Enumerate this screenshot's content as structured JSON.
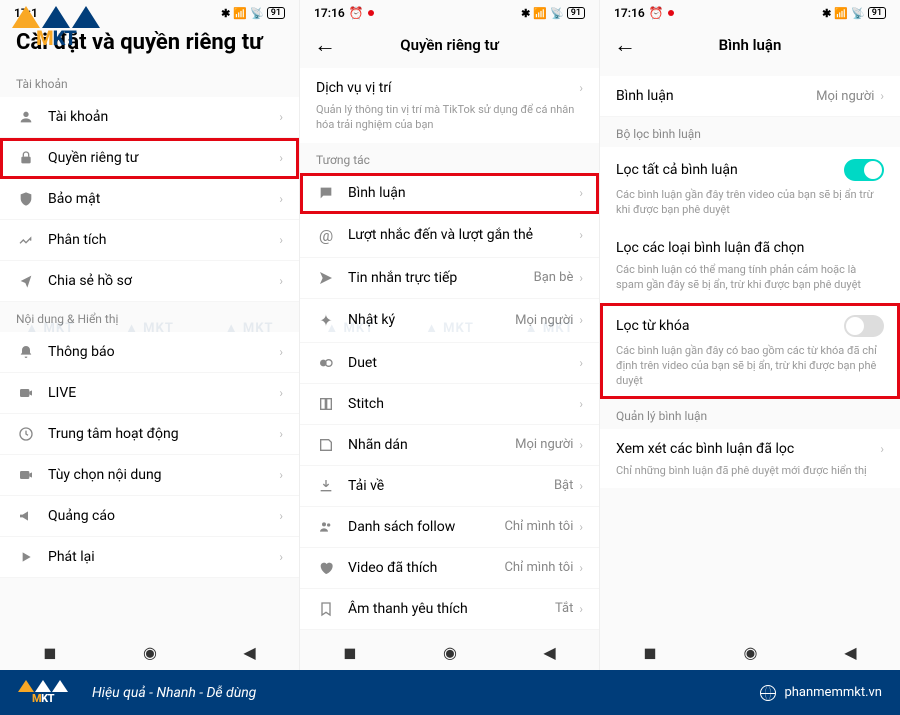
{
  "status": {
    "time1": "17:1",
    "time2": "17:16",
    "time3": "17:16",
    "alarm": "⏰",
    "battery": "91",
    "signal": "📶"
  },
  "screen1": {
    "title": "Cài đặt và quyền riêng tư",
    "section_account": "Tài khoản",
    "account": "Tài khoản",
    "privacy": "Quyền riêng tư",
    "security": "Bảo mật",
    "analytics": "Phân tích",
    "share": "Chia sẻ hồ sơ",
    "section_content": "Nội dung & Hiển thị",
    "notifications": "Thông báo",
    "live": "LIVE",
    "activity": "Trung tâm hoạt động",
    "content_pref": "Tùy chọn nội dung",
    "ads": "Quảng cáo",
    "playback": "Phát lại"
  },
  "screen2": {
    "title": "Quyền riêng tư",
    "location": "Dịch vụ vị trí",
    "location_desc": "Quản lý thông tin vị trí mà TikTok sử dụng để cá nhân hóa trải nghiệm của bạn",
    "section_interact": "Tương tác",
    "comments": "Bình luận",
    "mentions": "Lượt nhắc đến và lượt gắn thẻ",
    "dm": "Tin nhắn trực tiếp",
    "dm_val": "Bạn bè",
    "story": "Nhật ký",
    "story_val": "Mọi người",
    "duet": "Duet",
    "stitch": "Stitch",
    "sticker": "Nhãn dán",
    "sticker_val": "Mọi người",
    "download": "Tải về",
    "download_val": "Bật",
    "following": "Danh sách follow",
    "following_val": "Chỉ mình tôi",
    "liked": "Video đã thích",
    "liked_val": "Chỉ mình tôi",
    "sounds": "Âm thanh yêu thích",
    "sounds_val": "Tắt"
  },
  "screen3": {
    "title": "Bình luận",
    "comments": "Bình luận",
    "comments_val": "Mọi người",
    "section_filter": "Bộ lọc bình luận",
    "filter_all": "Lọc tất cả bình luận",
    "filter_all_desc": "Các bình luận gần đây trên video của bạn sẽ bị ẩn trừ khi được bạn phê duyệt",
    "filter_selected": "Lọc các loại bình luận đã chọn",
    "filter_selected_desc": "Các bình luận có thể mang tính phản cảm hoặc là spam gần đây sẽ bị ẩn, trừ khi được bạn phê duyệt",
    "filter_keyword": "Lọc từ khóa",
    "filter_keyword_desc": "Các bình luận gần đây có bao gồm các từ khóa đã chỉ định trên video của bạn sẽ bị ẩn, trừ khi được bạn phê duyệt",
    "section_manage": "Quản lý bình luận",
    "review": "Xem xét các bình luận đã lọc",
    "review_desc": "Chỉ những bình luận đã phê duyệt mới được hiển thị"
  },
  "footer": {
    "slogan": "Hiệu quả - Nhanh - Dễ dùng",
    "site": "phanmemmkt.vn",
    "brand": "MKT"
  },
  "watermark": "MKT"
}
